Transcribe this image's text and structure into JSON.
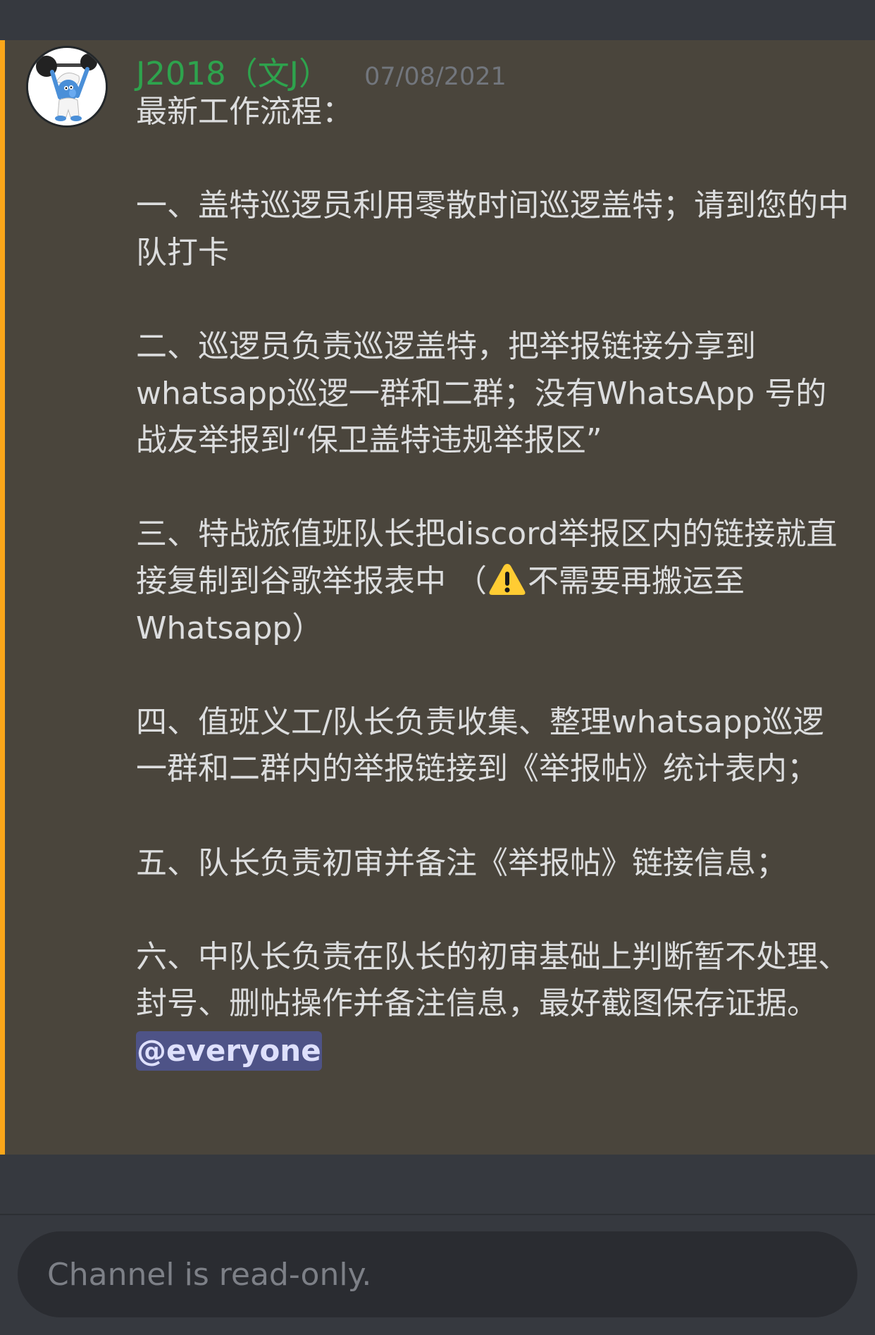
{
  "message": {
    "author": "J2018（文J）",
    "timestamp": "07/08/2021",
    "avatar_icon": "smurf-avatar-icon",
    "title": "最新工作流程：",
    "steps": [
      "一、盖特巡逻员利用零散时间巡逻盖特；请到您的中队打卡",
      "二、巡逻员负责巡逻盖特，把举报链接分享到whatsapp巡逻一群和二群；没有WhatsApp 号的战友举报到“保卫盖特违规举报区”",
      {
        "before": "三、特战旅值班队长把discord举报区内的链接就直接复制到谷歌举报表中 （",
        "icon": "warning-icon",
        "after": "不需要再搬运至Whatsapp）"
      },
      "四、值班义工/队长负责收集、整理whatsapp巡逻一群和二群内的举报链接到《举报帖》统计表内；",
      "五、队长负责初审并备注《举报帖》链接信息；",
      "六、中队长负责在队长的初审基础上判断暂不处理、封号、删帖操作并备注信息，最好截图保存证据。"
    ],
    "mention": "@everyone"
  },
  "composer": {
    "placeholder": "Channel is read-only."
  },
  "colors": {
    "background": "#36393f",
    "message_highlight": "#4a453c",
    "mention_bar": "#faa61a",
    "username": "#2ea34d",
    "text": "#dcddde",
    "mention_bg": "#4e5387"
  }
}
